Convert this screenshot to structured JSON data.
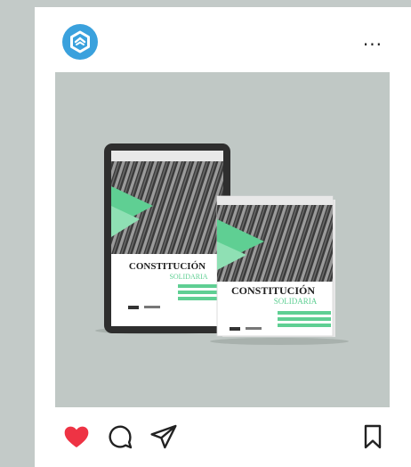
{
  "post": {
    "menu_label": "...",
    "image": {
      "alt": "CONSTITUCIÓN SOLIDARIA product mockup",
      "tablet_title": "CONSTITUCIÓN",
      "tablet_subtitle": "SOLIDARIA",
      "book_title": "CONSTITUCIÓN",
      "book_subtitle": "SOLIDARIA"
    }
  },
  "actions": {
    "like_icon": "heart-icon",
    "comment_icon": "comment-icon",
    "share_icon": "send-icon",
    "save_icon": "bookmark-icon",
    "like_color": "#ee3344"
  },
  "colors": {
    "background": "#c3cac8",
    "card": "#ffffff",
    "avatar": "#3aa1dd",
    "accent_green": "#5fcf93"
  }
}
